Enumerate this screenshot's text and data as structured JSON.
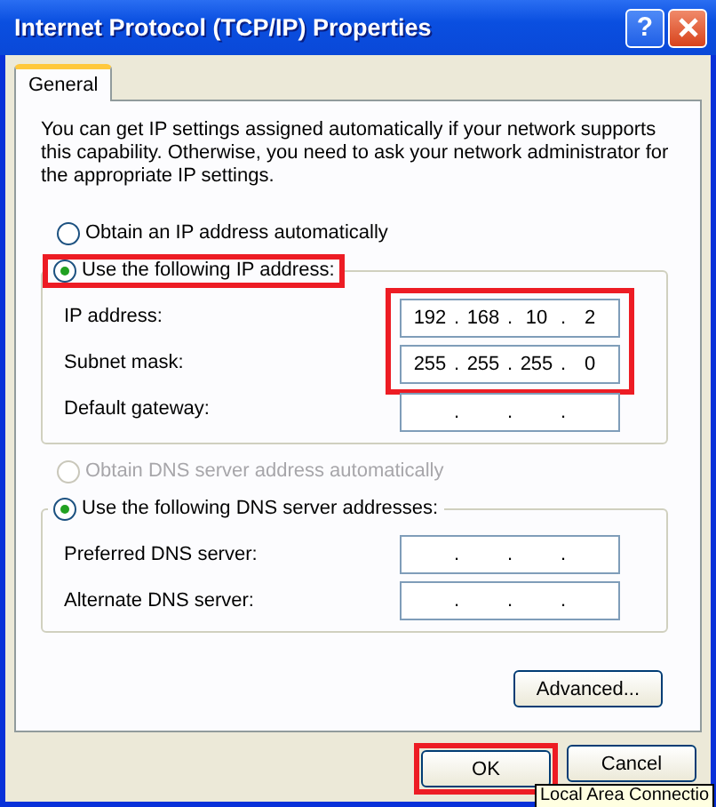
{
  "window": {
    "title": "Internet Protocol (TCP/IP) Properties",
    "help": "?"
  },
  "tabs": [
    {
      "label": "General",
      "selected": true
    }
  ],
  "intro": "You can get IP settings assigned automatically if your network supports this capability. Otherwise, you need to ask your network administrator for the appropriate IP settings.",
  "ip_options": [
    {
      "label": "Obtain an IP address automatically",
      "selected": false,
      "disabled": false,
      "highlighted": false
    },
    {
      "label": "Use the following IP address:",
      "selected": true,
      "disabled": false,
      "highlighted": true
    }
  ],
  "ip_fields_highlighted": true,
  "ip_fields": [
    {
      "label": "IP address:",
      "octets": [
        "192",
        "168",
        "10",
        "2"
      ],
      "dots": [
        ".",
        ".",
        "."
      ]
    },
    {
      "label": "Subnet mask:",
      "octets": [
        "255",
        "255",
        "255",
        "0"
      ],
      "dots": [
        ".",
        ".",
        "."
      ]
    },
    {
      "label": "Default gateway:",
      "dots": [
        ".",
        ".",
        "."
      ]
    }
  ],
  "dns_options": [
    {
      "label": "Obtain DNS server address automatically",
      "selected": false,
      "disabled": true,
      "highlighted": false
    },
    {
      "label": "Use the following DNS server addresses:",
      "selected": true,
      "disabled": false,
      "highlighted": false
    }
  ],
  "dns_fields": [
    {
      "label": "Preferred DNS server:",
      "dots": [
        ".",
        ".",
        "."
      ]
    },
    {
      "label": "Alternate DNS server:",
      "dots": [
        ".",
        ".",
        "."
      ]
    }
  ],
  "advanced_button": "Advanced...",
  "buttons": [
    {
      "label": "OK",
      "highlighted": true
    },
    {
      "label": "Cancel",
      "highlighted": false
    }
  ],
  "tooltip": "Local Area Connectio"
}
